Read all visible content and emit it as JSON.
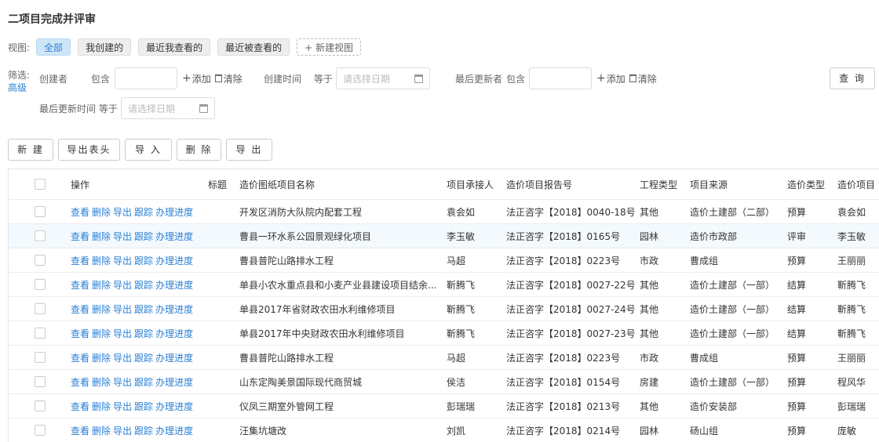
{
  "page": {
    "title": "二项目完成并评审"
  },
  "views": {
    "label": "视图:",
    "items": [
      "全部",
      "我创建的",
      "最近我查看的",
      "最近被查看的"
    ],
    "new_view": "+ 新建视图"
  },
  "filter": {
    "label": "筛选:",
    "advanced": "高级",
    "creator": "创建者",
    "contains": "包含",
    "add": "添加",
    "clear": "清除",
    "create_time": "创建时间",
    "equals": "等于",
    "date_placeholder": "请选择日期",
    "last_updater": "最后更新者",
    "last_update_time": "最后更新时间"
  },
  "query_button": "查 询",
  "toolbar": {
    "new": "新 建",
    "export_header": "导出表头",
    "import": "导 入",
    "delete": "删 除",
    "export": "导 出"
  },
  "table": {
    "headers": [
      "操作",
      "标题",
      "造价图纸项目名称",
      "项目承接人",
      "造价项目报告号",
      "工程类型",
      "项目来源",
      "造价类型",
      "造价项目"
    ],
    "ops": [
      "查看",
      "删除",
      "导出",
      "跟踪",
      "办理进度"
    ],
    "rows": [
      [
        "开发区消防大队院内配套工程",
        "袁会如",
        "法正咨字【2018】0040-18号",
        "其他",
        "造价土建部（二部）",
        "预算",
        "袁会如"
      ],
      [
        "曹县一环水系公园景观绿化项目",
        "李玉敏",
        "法正咨字【2018】0165号",
        "园林",
        "造价市政部",
        "评审",
        "李玉敏"
      ],
      [
        "曹县普陀山路排水工程",
        "马超",
        "法正咨字【2018】0223号",
        "市政",
        "曹成组",
        "预算",
        "王丽丽"
      ],
      [
        "单县小农水重点县和小麦产业县建设项目结余...",
        "靳腾飞",
        "法正咨字【2018】0027-22号",
        "其他",
        "造价土建部（一部）",
        "结算",
        "靳腾飞"
      ],
      [
        "单县2017年省财政农田水利维修项目",
        "靳腾飞",
        "法正咨字【2018】0027-24号",
        "其他",
        "造价土建部（一部）",
        "结算",
        "靳腾飞"
      ],
      [
        "单县2017年中央财政农田水利维修项目",
        "靳腾飞",
        "法正咨字【2018】0027-23号",
        "其他",
        "造价土建部（一部）",
        "结算",
        "靳腾飞"
      ],
      [
        "曹县普陀山路排水工程",
        "马超",
        "法正咨字【2018】0223号",
        "市政",
        "曹成组",
        "预算",
        "王丽丽"
      ],
      [
        "山东定陶美景国际现代商贸城",
        "侯洁",
        "法正咨字【2018】0154号",
        "房建",
        "造价土建部（一部）",
        "预算",
        "程风华"
      ],
      [
        "仪凤三期室外管网工程",
        "彭瑞瑞",
        "法正咨字【2018】0213号",
        "其他",
        "造价安装部",
        "预算",
        "彭瑞瑞"
      ],
      [
        "汪集坑塘改",
        "刘凯",
        "法正咨字【2018】0214号",
        "园林",
        "砀山组",
        "预算",
        "庞敏"
      ]
    ]
  }
}
